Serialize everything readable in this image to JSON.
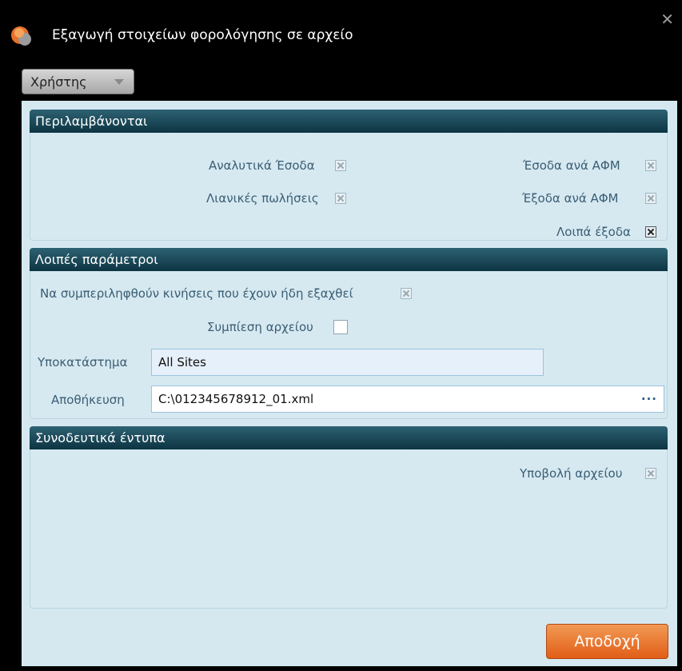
{
  "window": {
    "title": "Εξαγωγή στοιχείων φορολόγησης σε αρχείο",
    "close_glyph": "✕",
    "user_button": "Χρήστης"
  },
  "groups": {
    "included": {
      "header": "Περιλαμβάνονται",
      "items": [
        {
          "label": "Αναλυτικά Έσοδα",
          "checked": true
        },
        {
          "label": "Έσοδα ανά ΑΦΜ",
          "checked": true
        },
        {
          "label": "Λιανικές πωλήσεις",
          "checked": true
        },
        {
          "label": "Έξοδα ανά ΑΦΜ",
          "checked": true
        },
        {
          "label": "Λοιπά έξοδα",
          "checked": true
        }
      ]
    },
    "other_params": {
      "header": "Λοιπές παράμετροι",
      "include_exported_label": "Να συμπεριληφθούν κινήσεις που έχουν ήδη εξαχθεί",
      "include_exported_checked": true,
      "compress_label": "Συμπίεση αρχείου",
      "compress_checked": false,
      "branch_label": "Υποκατάστημα",
      "branch_value": "All Sites",
      "save_label": "Αποθήκευση",
      "save_value": "C:\\012345678912_01.xml",
      "browse_glyph": "···"
    },
    "attachments": {
      "header": "Συνοδευτικά έντυπα",
      "submit_label": "Υποβολή αρχείου",
      "submit_checked": true
    }
  },
  "accept_button": "Αποδοχή",
  "colors": {
    "header_bg": "#1b4a5a",
    "panel_bg": "#d5e8f0",
    "accent_orange": "#e8702a"
  }
}
